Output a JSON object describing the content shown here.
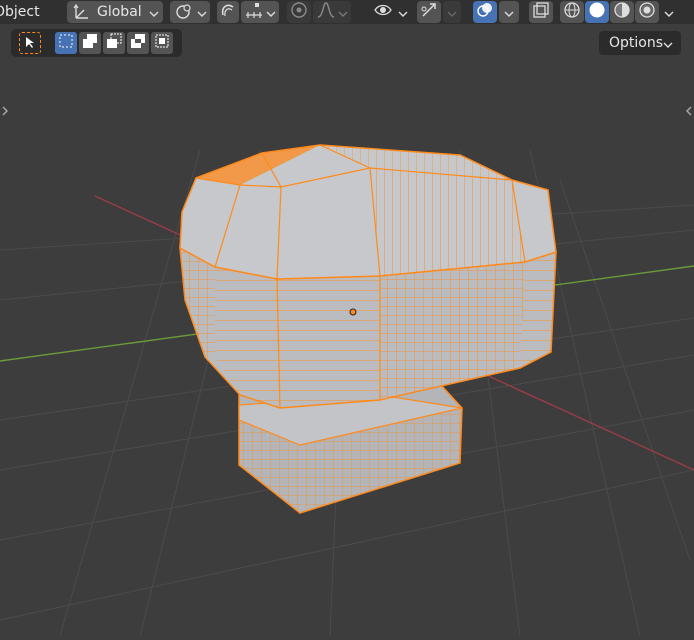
{
  "header": {
    "mode_label": "Object",
    "orientation_label": "Global",
    "icons": [
      "transform-orientation-icon",
      "pivot-icon",
      "snap-icon",
      "snap-target-icon",
      "proportional-edit-icon",
      "falloff-icon",
      "visibility-icon",
      "gizmo-icon",
      "overlay-icon",
      "xray-icon",
      "wireframe-shading-icon",
      "solid-shading-icon",
      "material-shading-icon",
      "rendered-shading-icon"
    ]
  },
  "tool_settings": {
    "options_label": "Options",
    "icons": [
      "select-cursor-icon",
      "select-new-icon",
      "select-extend-icon",
      "select-subtract-icon",
      "select-difference-icon",
      "select-intersect-icon"
    ]
  },
  "viewport": {
    "object_outline_color": "#ff8a1c",
    "object_face_color": "#b7b9bc",
    "x_axis_color": "#9b3b4a",
    "y_axis_color": "#6a9a3a",
    "grid_color": "#4a4a4a",
    "background_color": "#3d3d3d"
  }
}
